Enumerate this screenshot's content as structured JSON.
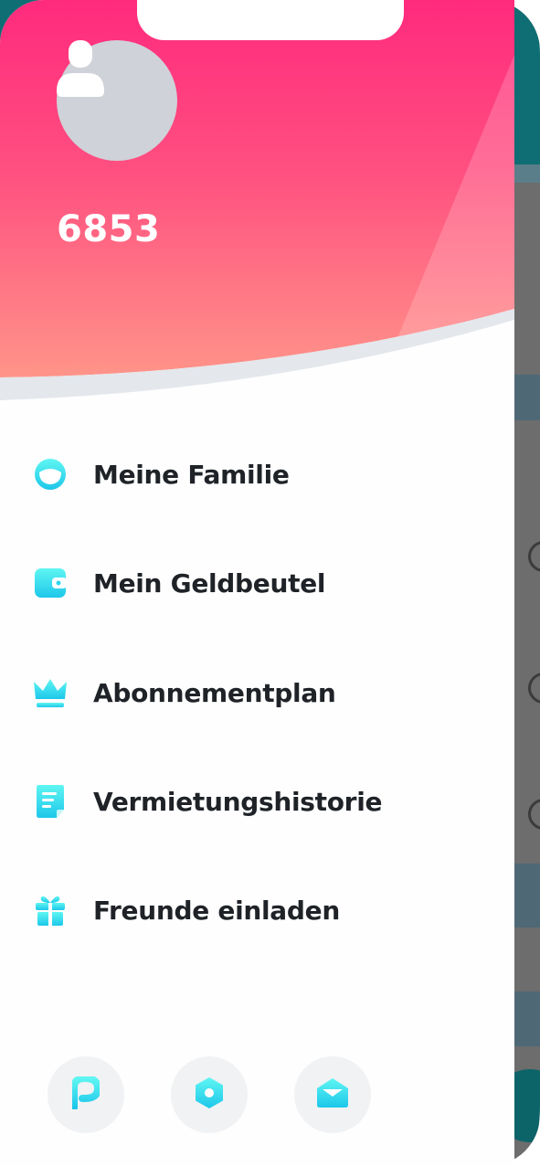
{
  "profile": {
    "user_id": "6853",
    "avatar_icon": "user-silhouette-icon"
  },
  "menu": {
    "items": [
      {
        "label": "Meine Familie",
        "icon": "family-icon"
      },
      {
        "label": "Mein Geldbeutel",
        "icon": "wallet-icon"
      },
      {
        "label": "Abonnementplan",
        "icon": "crown-icon"
      },
      {
        "label": "Vermietungshistorie",
        "icon": "document-icon"
      },
      {
        "label": "Freunde einladen",
        "icon": "gift-icon"
      }
    ]
  },
  "bottom_actions": [
    {
      "icon": "p-logo-icon"
    },
    {
      "icon": "hexagon-settings-icon"
    },
    {
      "icon": "envelope-icon"
    }
  ],
  "colors": {
    "header_gradient_top": "#ff2d7f",
    "header_gradient_bottom": "#ff8d8a",
    "accent_gradient_top": "#4ef3f2",
    "accent_gradient_bottom": "#1ec8e8",
    "label_text": "#1f2328"
  }
}
